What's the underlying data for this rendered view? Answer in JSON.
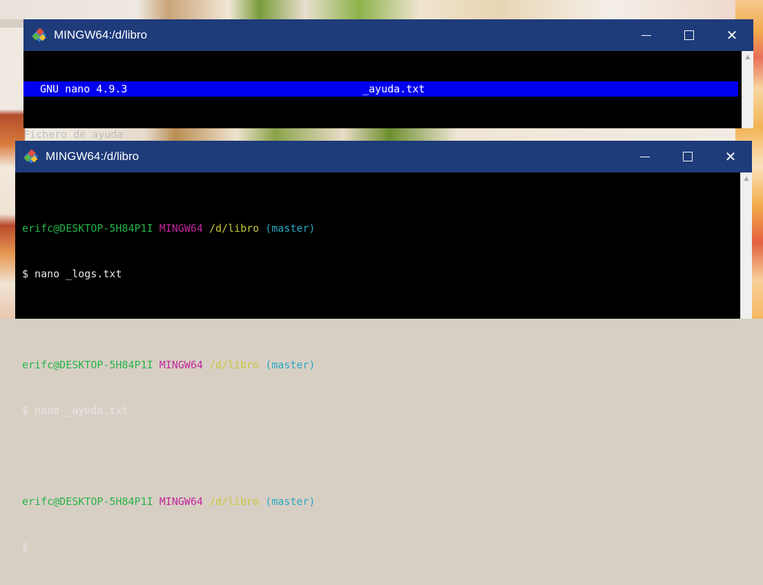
{
  "window_top": {
    "title": "MINGW64:/d/libro",
    "nano": {
      "version": "GNU nano 4.9.3",
      "filename": "_ayuda.txt"
    },
    "content_lines": [
      "Fichero de ayuda"
    ]
  },
  "window_bottom": {
    "title": "MINGW64:/d/libro",
    "prompts": [
      {
        "user_host": "erifc@DESKTOP-5H84P1I",
        "system": "MINGW64",
        "path": "/d/libro",
        "branch": "(master)",
        "command": "$ nano _logs.txt"
      },
      {
        "user_host": "erifc@DESKTOP-5H84P1I",
        "system": "MINGW64",
        "path": "/d/libro",
        "branch": "(master)",
        "command": "$ nano _ayuda.txt"
      },
      {
        "user_host": "erifc@DESKTOP-5H84P1I",
        "system": "MINGW64",
        "path": "/d/libro",
        "branch": "(master)",
        "command": "$"
      }
    ]
  },
  "controls": {
    "minimize": "—",
    "close": "✕"
  },
  "colors": {
    "titlebar": "#1e3b7a",
    "nano_header": "#0000ee",
    "prompt_user": "#26b34a",
    "prompt_system": "#c0269c",
    "prompt_path": "#c8c83c",
    "prompt_branch": "#29a8c4"
  },
  "icons": [
    "git-for-windows-icon",
    "minimize-icon",
    "maximize-icon",
    "close-icon",
    "scroll-up-arrow-icon"
  ]
}
